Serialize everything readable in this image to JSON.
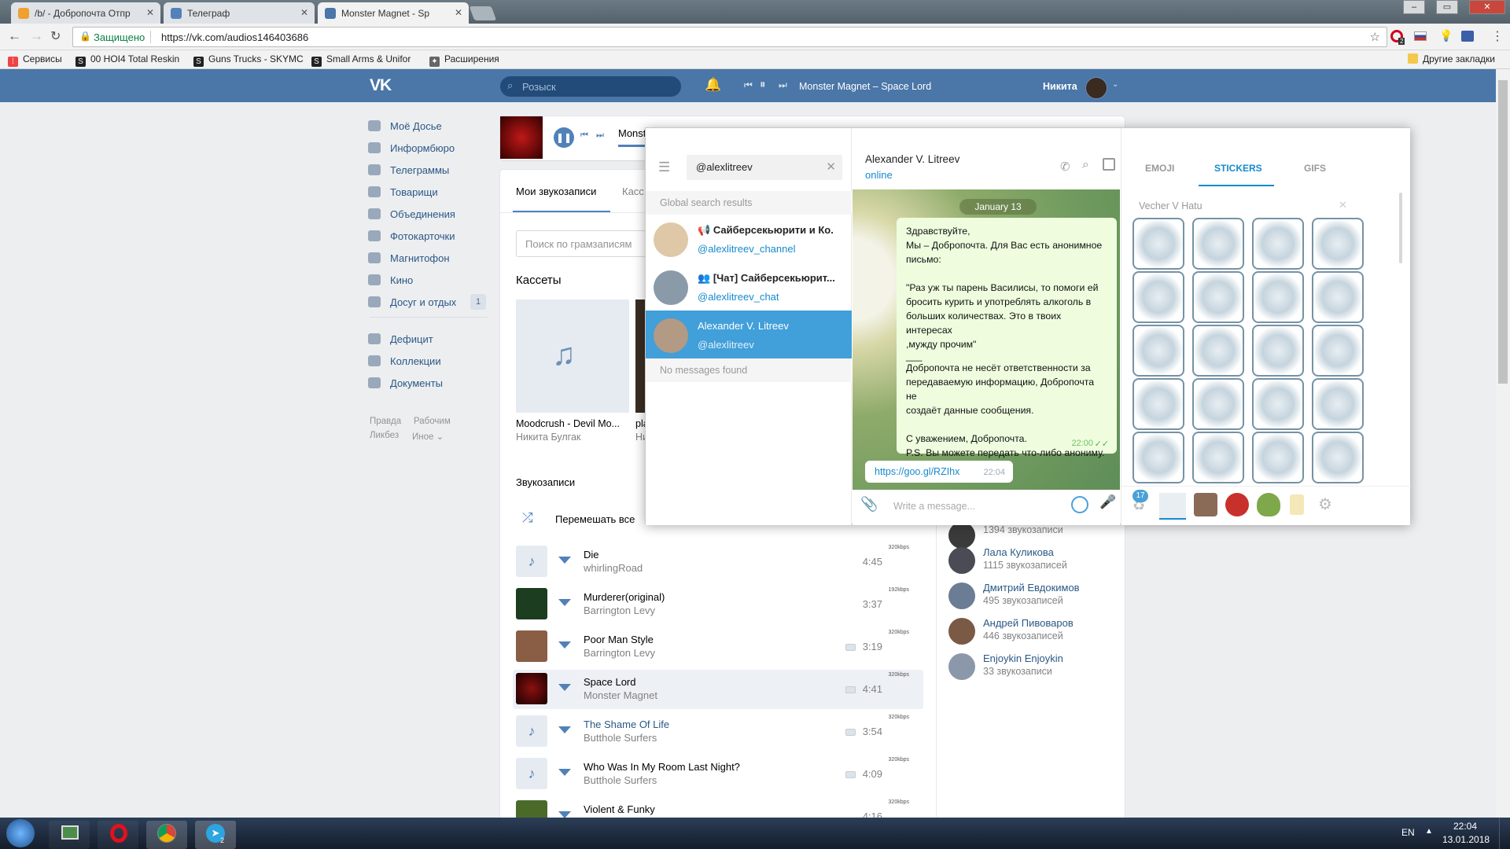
{
  "browser": {
    "tabs": [
      {
        "title": "/b/ - Добропочта Отпр"
      },
      {
        "title": "Телеграф"
      },
      {
        "title": "Monster Magnet - Sp"
      }
    ],
    "secure_label": "Защищено",
    "url": "https://vk.com/audios146403686",
    "bookmarks": [
      {
        "label": "Сервисы"
      },
      {
        "label": "00 HOI4 Total Reskin"
      },
      {
        "label": "Guns Trucks - SKYMC"
      },
      {
        "label": "Small Arms & Unifor"
      },
      {
        "label": "Расширения"
      }
    ],
    "other_bookmarks": "Другие закладки",
    "ext_badge": "2"
  },
  "vk": {
    "search_placeholder": "Розыск",
    "player_track": "Monster Magnet – Space Lord",
    "user_name": "Никита",
    "menu": [
      {
        "label": "Моё Досье"
      },
      {
        "label": "Информбюро"
      },
      {
        "label": "Телеграммы"
      },
      {
        "label": "Товарищи"
      },
      {
        "label": "Объединения"
      },
      {
        "label": "Фотокарточки"
      },
      {
        "label": "Магнитофон"
      },
      {
        "label": "Кино"
      },
      {
        "label": "Досуг и отдых",
        "badge": "1"
      },
      {
        "label": "Дефицит"
      },
      {
        "label": "Коллекции"
      },
      {
        "label": "Документы"
      }
    ],
    "footer": {
      "l1": "Правда",
      "l2": "Рабочим",
      "l3": "Ликбез",
      "l4": "Иное ⌄"
    },
    "mini_player_title": "Monst",
    "tabs": {
      "mine": "Мои звукозаписи",
      "cassettes": "Касс"
    },
    "audio_search_placeholder": "Поиск по грамзаписям",
    "cassettes_title": "Кассеты",
    "cassette1": {
      "title": "Moodcrush - Devil Mo...",
      "author": "Никита Булгак"
    },
    "cassette2": {
      "title": "pla",
      "author": "Ни"
    },
    "audios_title": "Звукозаписи",
    "shuffle": "Перемешать все",
    "tracks": [
      {
        "title": "Die",
        "artist": "whirlingRoad",
        "dur": "4:45",
        "kbps": "320kbps"
      },
      {
        "title": "Murderer(original)",
        "artist": "Barrington Levy",
        "dur": "3:37",
        "kbps": "192kbps"
      },
      {
        "title": "Poor Man Style",
        "artist": "Barrington Levy",
        "dur": "3:19",
        "kbps": "320kbps"
      },
      {
        "title": "Space Lord",
        "artist": "Monster Magnet",
        "dur": "4:41",
        "kbps": "320kbps"
      },
      {
        "title": "The Shame Of Life",
        "artist": "Butthole Surfers",
        "dur": "3:54",
        "kbps": "320kbps"
      },
      {
        "title": "Who Was In My Room Last Night?",
        "artist": "Butthole Surfers",
        "dur": "4:09",
        "kbps": "320kbps"
      },
      {
        "title": "Violent & Funky",
        "artist": "",
        "dur": "4:16",
        "kbps": "320kbps"
      }
    ],
    "friends": [
      {
        "name": "",
        "count": "1394 звукозаписи"
      },
      {
        "name": "Лала Куликова",
        "count": "1115 звукозаписей"
      },
      {
        "name": "Дмитрий Евдокимов",
        "count": "495 звукозаписей"
      },
      {
        "name": "Андрей Пивоваров",
        "count": "446 звукозаписей"
      },
      {
        "name": "Enjoykin Enjoykin",
        "count": "33 звукозаписи"
      }
    ]
  },
  "telegram": {
    "search_value": "@alexlitreev",
    "global_label": "Global search results",
    "results": [
      {
        "name": "Сайберсекьюрити и Ко.",
        "username": "@alexlitreev_channel"
      },
      {
        "name": "[Чат] Сайберсекьюрит...",
        "username": "@alexlitreev_chat"
      },
      {
        "name": "Alexander V. Litreev",
        "username": "@alexlitreev"
      }
    ],
    "no_messages": "No messages found",
    "chat_name": "Alexander V. Litreev",
    "chat_status": "online",
    "date": "January 13",
    "message": {
      "l1": "Здравствуйте,",
      "l2": "Мы – Добропочта. Для Вас есть анонимное",
      "l3": "письмо:",
      "l4": "\"Раз уж ты парень Василисы, то помоги ей",
      "l5": "бросить курить и употреблять алкоголь в",
      "l6": "больших количествах. Это в твоих интересах",
      "l7": ",мужду прочим\"",
      "l8": "___",
      "l9": "Добропочта не несёт ответственности за",
      "l10": "передаваемую информацию, Добропочта не",
      "l11": "создаёт данные сообщения.",
      "l12": "С уважением, Добропочта.",
      "l13": "P.S. Вы можете передать что-либо анониму.",
      "time": "22:00"
    },
    "link": {
      "text": "https://goo.gl/RZIhx",
      "time": "22:04"
    },
    "input_placeholder": "Write a message...",
    "panel_tabs": {
      "emoji": "EMOJI",
      "stickers": "STICKERS",
      "gifs": "GIFS"
    },
    "pack_title": "Vecher V Hatu",
    "recent_badge": "17"
  },
  "taskbar": {
    "lang": "EN",
    "time": "22:04",
    "date": "13.01.2018",
    "tg_badge": "2"
  },
  "colors": {
    "vk_blue": "#4a76a8",
    "tg_blue": "#168acd",
    "tg_selected": "#419fd9"
  }
}
